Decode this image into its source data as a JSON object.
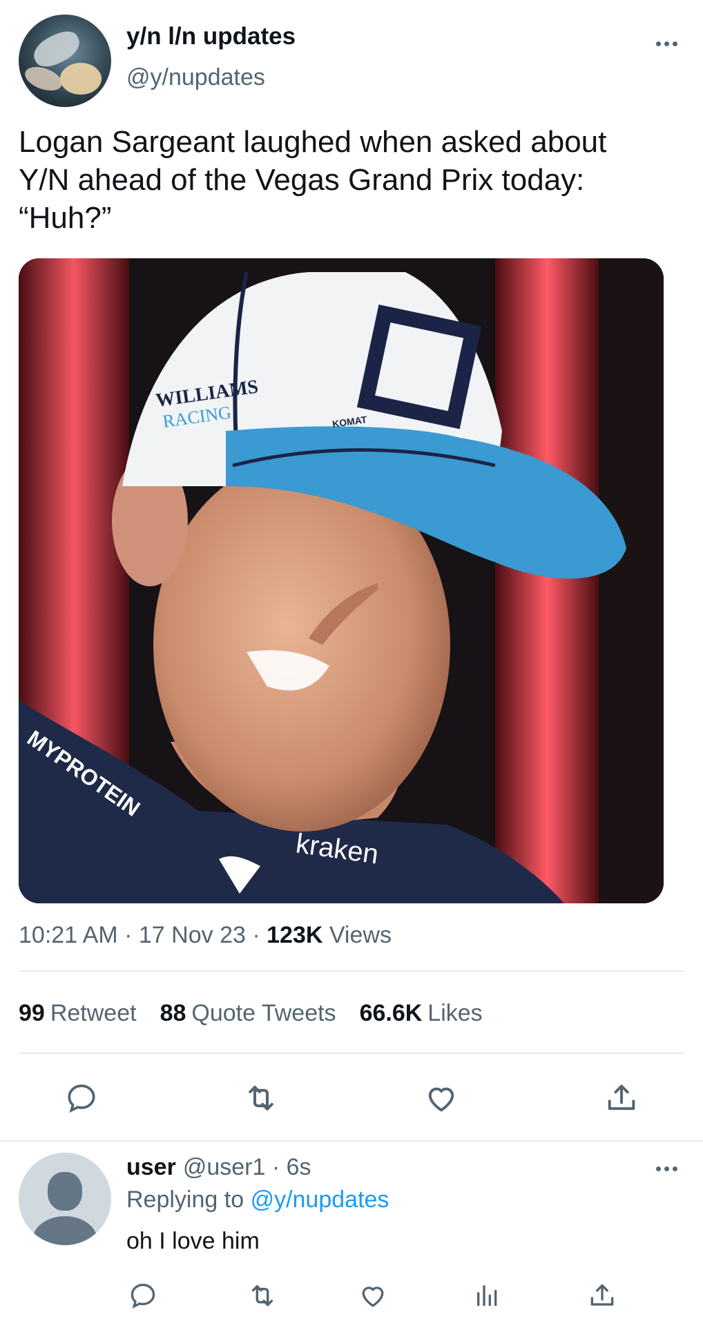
{
  "tweet": {
    "display_name": "y/n l/n updates",
    "handle": "@y/nupdates",
    "text": "Logan Sargeant laughed when asked about\nY/N ahead of the Vegas Grand Prix today:\n“Huh?”",
    "time": "10:21 AM",
    "date": "17 Nov 23",
    "views_count": "123K",
    "views_label": "Views",
    "retweets_count": "99",
    "retweets_label": "Retweet",
    "quotes_count": "88",
    "quotes_label": "Quote Tweets",
    "likes_count": "66.6K",
    "likes_label": "Likes",
    "media": {
      "cap_text_1": "WILLIAMS",
      "cap_text_2": "RACING",
      "cap_logo": "L2",
      "brim_text": "KOMAT",
      "shirt_text_1": "MYPROTEIN",
      "shirt_text_2": "kraken"
    }
  },
  "reply": {
    "display_name": "user",
    "handle": "@user1",
    "time": "6s",
    "replying_prefix": "Replying to",
    "replying_handle": "@y/nupdates",
    "text": "oh I love him"
  },
  "colors": {
    "text": "#0f1419",
    "muted": "#536471",
    "link": "#1d9bf0",
    "divider": "#e7eaed"
  },
  "icons": [
    "more-icon",
    "reply-icon",
    "retweet-icon",
    "like-icon",
    "share-icon",
    "analytics-icon"
  ]
}
